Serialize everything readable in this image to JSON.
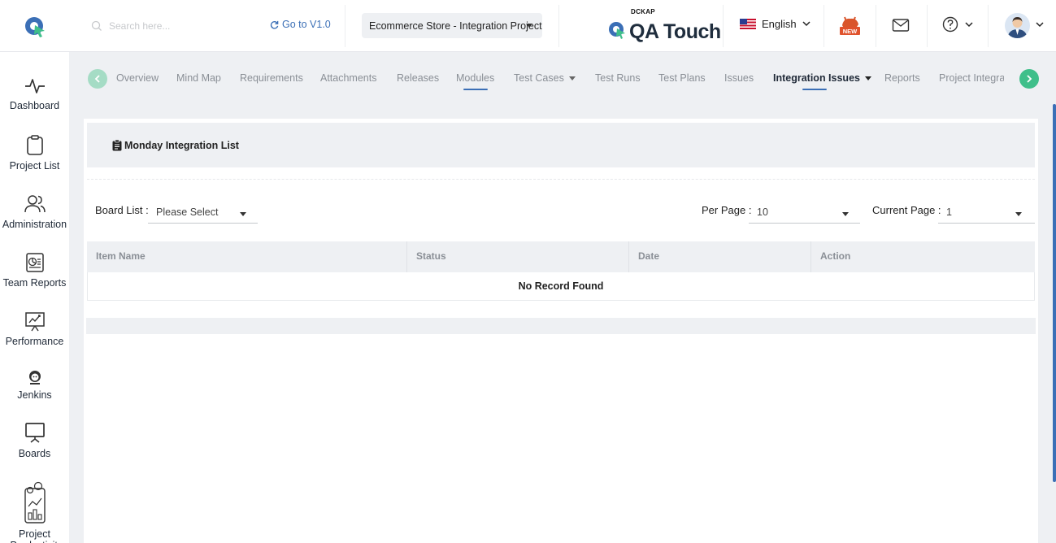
{
  "header": {
    "search_placeholder": "Search here...",
    "goto_label": "Go to V1.0",
    "project": "Ecommerce Store - Integration Project",
    "brand_small": "DCKAP",
    "brand_name": "QA Touch",
    "language": "English",
    "new_badge": "NEW"
  },
  "sidebar": {
    "items": [
      {
        "label": "Dashboard"
      },
      {
        "label": "Project List"
      },
      {
        "label": "Administration"
      },
      {
        "label": "Team Reports"
      },
      {
        "label": "Performance"
      },
      {
        "label": "Jenkins"
      },
      {
        "label": "Boards"
      },
      {
        "label": "Project Productivity"
      }
    ]
  },
  "tabs": {
    "items": [
      {
        "label": "Overview"
      },
      {
        "label": "Mind Map"
      },
      {
        "label": "Requirements"
      },
      {
        "label": "Attachments"
      },
      {
        "label": "Releases"
      },
      {
        "label": "Modules"
      },
      {
        "label": "Test Cases"
      },
      {
        "label": "Test Runs"
      },
      {
        "label": "Test Plans"
      },
      {
        "label": "Issues"
      },
      {
        "label": "Integration Issues"
      },
      {
        "label": "Reports"
      },
      {
        "label": "Project Integra"
      }
    ],
    "active": "Integration Issues"
  },
  "panel": {
    "title": "Monday Integration List",
    "board_list_label": "Board List :",
    "board_list_value": "Please Select",
    "per_page_label": "Per Page :",
    "per_page_value": "10",
    "current_page_label": "Current Page :",
    "current_page_value": "1",
    "columns": [
      "Item Name",
      "Status",
      "Date",
      "Action"
    ],
    "empty_message": "No Record Found"
  },
  "colors": {
    "accent": "#3b6fb6",
    "nav_arrow": "#3fbf8a",
    "background": "#eef0f3"
  }
}
